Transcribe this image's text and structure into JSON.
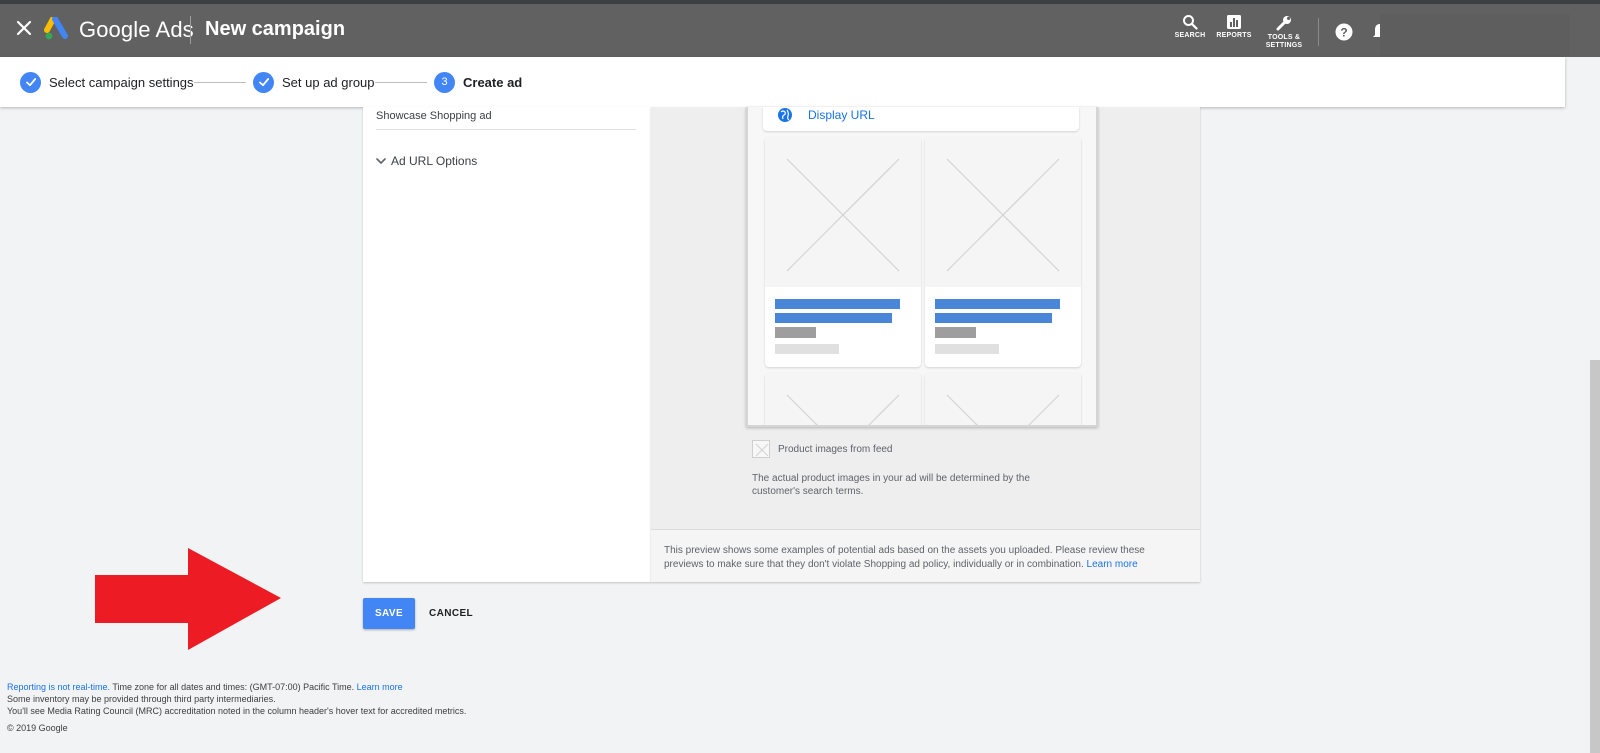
{
  "header": {
    "brand": "Google Ads",
    "page_title": "New campaign",
    "tools": [
      {
        "label": "SEARCH",
        "icon": "search-icon"
      },
      {
        "label": "REPORTS",
        "icon": "reports-icon"
      },
      {
        "label": "TOOLS &",
        "label2": "SETTINGS",
        "icon": "wrench-icon"
      }
    ]
  },
  "stepper": {
    "steps": [
      {
        "label": "Select campaign settings",
        "state": "done"
      },
      {
        "label": "Set up ad group",
        "state": "done"
      },
      {
        "label": "Create ad",
        "number": "3",
        "state": "current"
      }
    ]
  },
  "editor": {
    "ad_name": "Showcase Shopping ad",
    "url_options_label": "Ad URL Options"
  },
  "preview": {
    "display_url": "Display URL",
    "product_images_label": "Product images from feed",
    "feed_description": "The actual product images in your ad will be determined by the customer's search terms.",
    "disclaimer": "This preview shows some examples of potential ads based on the assets you uploaded. Please review these previews to make sure that they don't violate Shopping ad policy, individually or in combination.",
    "learn_more": "Learn more"
  },
  "actions": {
    "save_label": "SAVE",
    "cancel_label": "CANCEL"
  },
  "footer": {
    "reporting_link": "Reporting is not real-time.",
    "timezone_text": " Time zone for all dates and times: (GMT-07:00) Pacific Time. ",
    "learn_more": "Learn more",
    "inventory_text": "Some inventory may be provided through third party intermediaries.",
    "mrc_text": "You'll see Media Rating Council (MRC) accreditation noted in the column header's hover text for accredited metrics.",
    "copyright": "© 2019 Google"
  },
  "colors": {
    "accent": "#4285f4",
    "link": "#1a73e8",
    "topbar": "#616161",
    "annotation_arrow": "#ed1c24"
  }
}
